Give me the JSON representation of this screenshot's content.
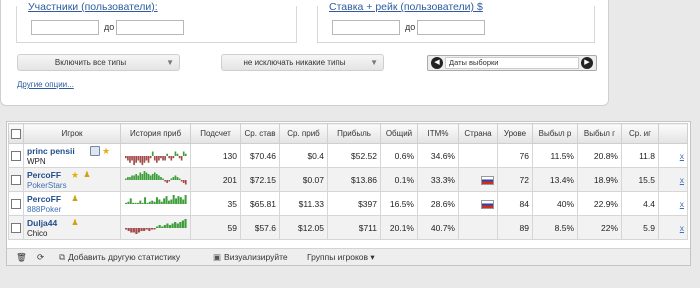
{
  "filters": {
    "participants_range": {
      "legend": "Участники (пользователи):",
      "from_value": "",
      "to_label": "до",
      "to_value": ""
    },
    "buyin_range": {
      "legend": "Ставка + рейк (пользователи) $",
      "from_value": "",
      "to_label": "до",
      "to_value": ""
    },
    "types_combo": "Включить все типы",
    "exclude_combo": "не исключать никакие типы",
    "date_picker": "Даты выборки",
    "other_options_link": "Другие опции..."
  },
  "table": {
    "headers": [
      "Игрок",
      "История приб",
      "Подсчет",
      "Ср. став",
      "Ср. приб",
      "Прибыль",
      "Общий",
      "ITM%",
      "Страна",
      "Урове",
      "Выбыл р",
      "Выбыл г",
      "Ср. иг"
    ],
    "rows": [
      {
        "name": "princ pensii",
        "site": "WPN",
        "count": "130",
        "avg_stake": "$70.46",
        "avg_profit": "$0.4",
        "profit": "$52.52",
        "roi": "0.6%",
        "itm": "34.6%",
        "country": "",
        "level": "76",
        "early_out": "11.5%",
        "late_out": "20.8%",
        "avg_players": "11.8",
        "remove": "x",
        "history": [
          -1,
          -2,
          -3,
          -2,
          -4,
          -3,
          -2,
          -3,
          -4,
          -3,
          -2,
          -3,
          -1,
          2,
          -2,
          -3,
          -2,
          -1,
          -2,
          -2,
          1,
          -1,
          -2,
          -1,
          2,
          1,
          -1,
          -2,
          2,
          1
        ]
      },
      {
        "name": "PercoFF",
        "site": "PokerStars",
        "count": "201",
        "avg_stake": "$72.15",
        "avg_profit": "$0.07",
        "profit": "$13.86",
        "roi": "0.1%",
        "itm": "33.3%",
        "country": "ru",
        "level": "72",
        "early_out": "13.4%",
        "late_out": "18.9%",
        "avg_players": "15.5",
        "remove": "x",
        "history": [
          1,
          2,
          2,
          3,
          3,
          4,
          3,
          5,
          4,
          6,
          5,
          4,
          3,
          4,
          5,
          4,
          3,
          2,
          1,
          -1,
          -2,
          -1,
          1,
          2,
          3,
          2,
          1,
          -1,
          -2,
          -3
        ]
      },
      {
        "name": "PercoFF",
        "site": "888Poker",
        "count": "35",
        "avg_stake": "$65.81",
        "avg_profit": "$11.33",
        "profit": "$397",
        "roi": "16.5%",
        "itm": "28.6%",
        "country": "ru",
        "level": "84",
        "early_out": "40%",
        "late_out": "22.9%",
        "avg_players": "4.4",
        "remove": "x",
        "history": [
          1,
          2,
          5,
          1,
          1,
          1,
          3,
          1,
          6,
          1,
          2,
          3,
          2,
          6,
          4,
          2,
          5,
          7,
          3,
          4,
          8,
          5,
          7,
          6,
          4,
          8
        ]
      },
      {
        "name": "Dulja44",
        "site": "Chico",
        "count": "59",
        "avg_stake": "$57.6",
        "avg_profit": "$12.05",
        "profit": "$711",
        "roi": "20.1%",
        "itm": "40.7%",
        "country": "",
        "level": "89",
        "early_out": "8.5%",
        "late_out": "22%",
        "avg_players": "5.9",
        "remove": "x",
        "history": [
          -1,
          -2,
          -3,
          -3,
          -4,
          -3,
          -2,
          -2,
          -1,
          -2,
          -1,
          -1,
          1,
          2,
          1,
          2,
          3,
          2,
          3,
          4,
          3,
          4,
          5,
          6
        ]
      }
    ]
  },
  "toolbar": {
    "add_stat": "Добавить другую статистику",
    "visualize": "Визуализируйте",
    "groups": "Группы игроков"
  },
  "colors": {
    "link": "#2f5c9e",
    "player_name": "#234e8c",
    "sparkline_positive": "#3f9e3a",
    "sparkline_negative": "#a34a4a"
  }
}
